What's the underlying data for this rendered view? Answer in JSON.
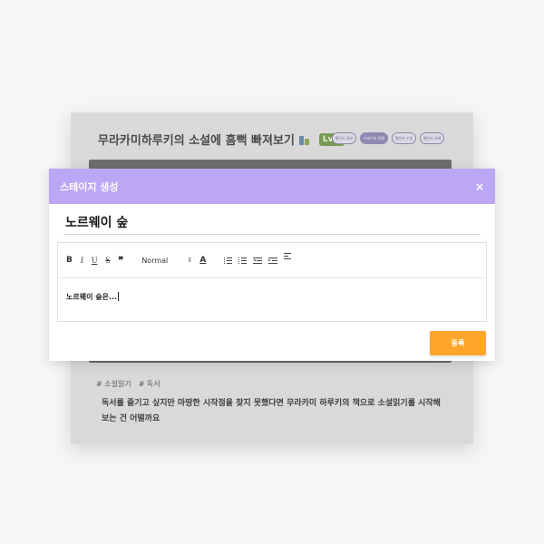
{
  "background_card": {
    "title": "무라카미하루키의 소설에 흠뻑 빠져보기",
    "level_badge": "Lv.2",
    "pills": [
      "챌린지 정보",
      "스테이지 현황",
      "챌린지 수정",
      "챌린지 삭제"
    ],
    "tags": [
      "# 소설읽기",
      "# 독서"
    ],
    "description": "독서를 즐기고 싶지만 마땅한 시작점을 찾지 못했다면 무라카미 하루키의 책으로 소설읽기를 시작해보는 건 어떨까요"
  },
  "modal": {
    "title": "스테이지 생성",
    "close_label": "×",
    "stage_name_value": "노르웨이 숲",
    "toolbar": {
      "bold": "B",
      "italic": "I",
      "underline": "U",
      "strike": "S",
      "quote": "❞",
      "header_select": "Normal",
      "select_arrow": "⇕",
      "color": "A"
    },
    "editor_content": "노르웨이 숲은...",
    "submit_label": "등록"
  },
  "colors": {
    "header": "#bba7f6",
    "submit": "#fda62a",
    "level_badge": "#7a9b56"
  }
}
